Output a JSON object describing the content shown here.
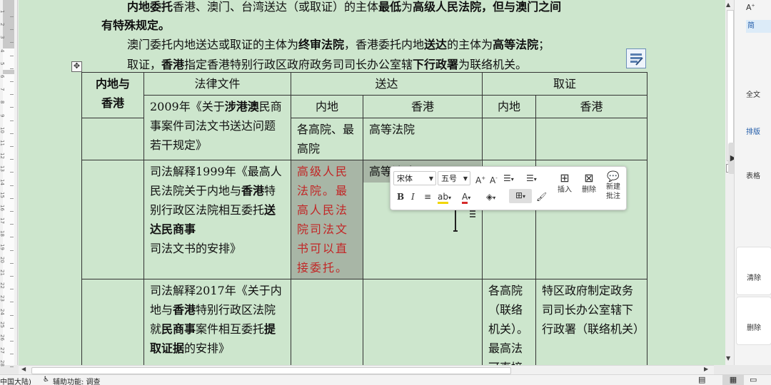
{
  "document": {
    "line1": {
      "part1": "内地委托",
      "part2": "香港、澳门、台湾送达（或取证）的主体",
      "part3": "最低",
      "part4": "为",
      "part5": "高级人民法院，但与澳门之间"
    },
    "line2": "有特殊规定。",
    "line3": {
      "part1": "澳门委托内地送达或取证的主体为",
      "part2": "终审法院",
      "part3": "，香港委托内地",
      "part4": "送达",
      "part5": "的主体为",
      "part6": "高等法院",
      "part7": "；"
    },
    "line4": {
      "part1": "取证，",
      "part2": "香港",
      "part3": "指定香港特别行政区政府政务司司长办公室辖",
      "part4": "下行政署",
      "part5": "为联络机关。"
    }
  },
  "table": {
    "corner": "内地与香港",
    "headers": {
      "law": "法律文件",
      "service": "送达",
      "evidence": "取证",
      "mainland": "内地",
      "hongkong": "香港"
    },
    "rows": [
      {
        "law": {
          "p1": "2009年《关于",
          "p2": "涉港澳",
          "p3": "民商事案件司法文书送达问题若干规定》"
        },
        "service_mainland": "各高院、最高院",
        "service_hk": "高等法院",
        "evidence_mainland": "",
        "evidence_hk": ""
      },
      {
        "law": {
          "p1": "司法解释1999年《最高人民法院关于内地与",
          "p2": "香港",
          "p3": "特别行政区法院相互委托",
          "p4": "送达民商事",
          "p5": "司法文书的安排》"
        },
        "service_mainland": "高级人民法院。最高人民法院司法文书可以直接委托。",
        "service_hk": "高等法院",
        "evidence_mainland": "",
        "evidence_hk": ""
      },
      {
        "law": {
          "p1": "司法解释2017年《关于内地与",
          "p2": "香港",
          "p3": "特别行政区法院就",
          "p4": "民商事",
          "p5": "案件相互委托",
          "p6": "提取证据",
          "p7": "的安排》"
        },
        "service_mainland": "",
        "service_hk": "",
        "evidence_mainland": "各高院（联络机关）。最高法可直接",
        "evidence_hk": "特区政府制定政务司司长办公室辖下行政署（联络机关）"
      }
    ]
  },
  "toolbar": {
    "font": "宋体",
    "size": "五号",
    "bold": "B",
    "italic": "I",
    "insert": "插入",
    "delete": "删除",
    "new_comment_1": "新建",
    "new_comment_2": "批注"
  },
  "right_pane": {
    "item1": "简",
    "item2": "全文",
    "item3": "排版",
    "item4": "表格",
    "item5": "清除",
    "item6": "删除"
  },
  "status": {
    "language": "中国大陆)",
    "accessibility": "辅助功能: 调查"
  },
  "ruler_numbers": [
    "1",
    "2",
    "3",
    "4",
    "5",
    "6",
    "7",
    "8",
    "9",
    "10",
    "11",
    "12",
    "13",
    "14",
    "15",
    "16",
    "17",
    "18",
    "19",
    "20",
    "21",
    "22",
    "23",
    "24",
    "25",
    "26",
    "27",
    "28"
  ]
}
